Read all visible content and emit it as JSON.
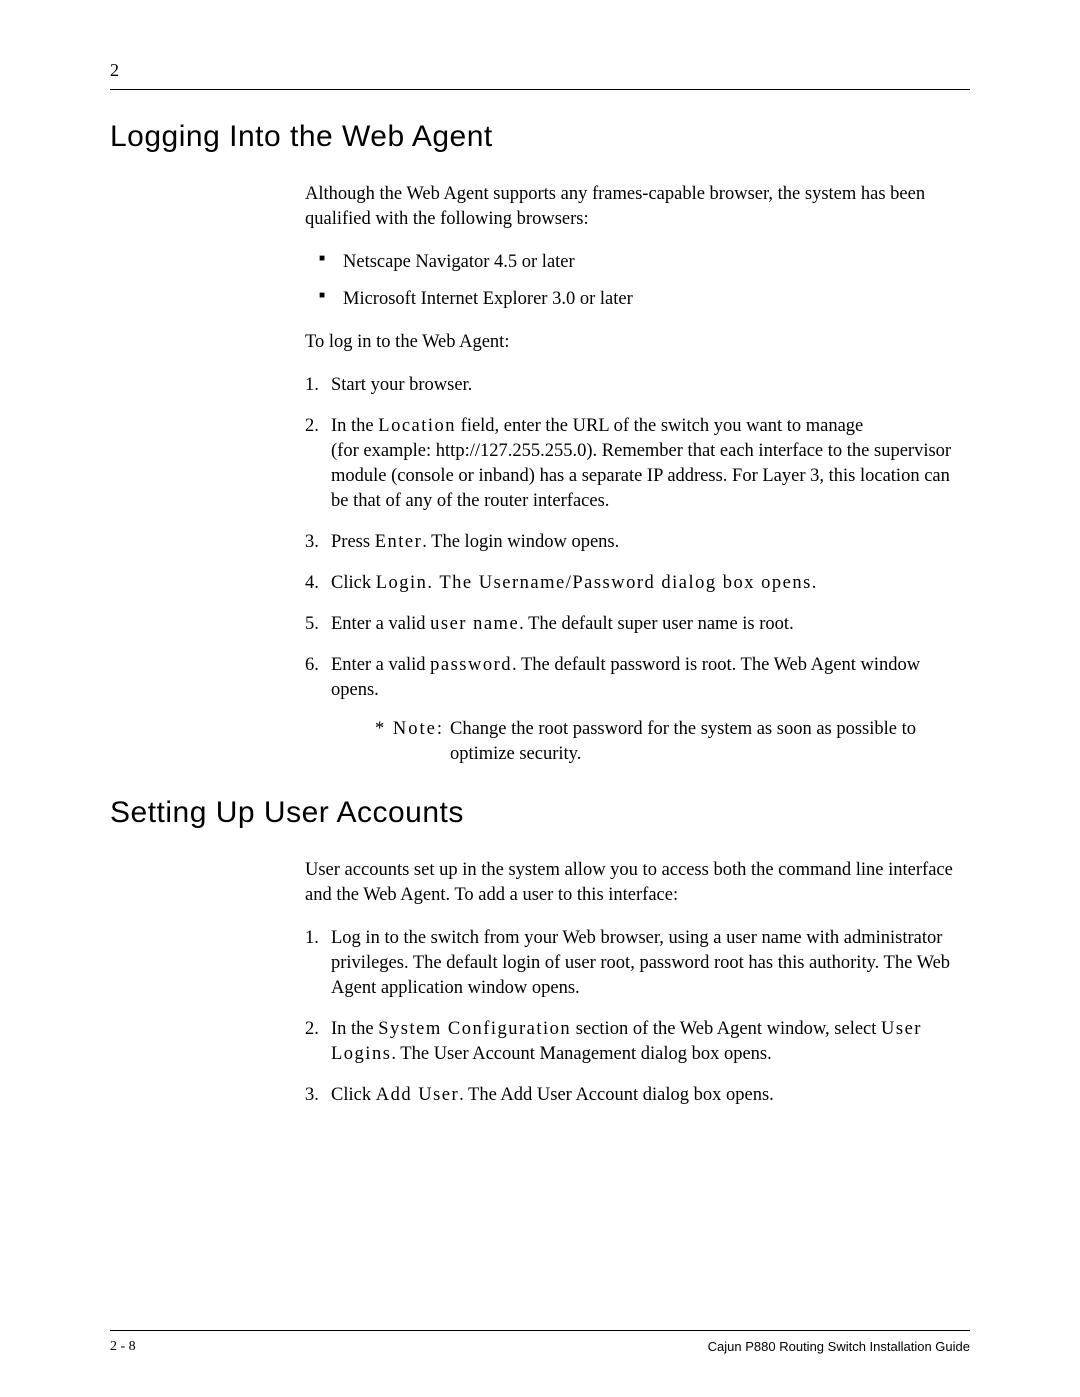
{
  "chapter_number": "2",
  "section1": {
    "heading": "Logging Into the Web Agent",
    "intro": "Although the Web Agent supports any frames-capable browser, the system has been qualified with the following browsers:",
    "bullets": [
      "Netscape Navigator 4.5 or later",
      "Microsoft Internet Explorer 3.0 or later"
    ],
    "lead": "To log in to the Web Agent:",
    "steps": {
      "s1": "Start your browser.",
      "s2a": "In the ",
      "s2b": "Location",
      "s2c": " field, enter the URL of the switch you want to manage",
      "s2d": "(for example: http://127.255.255.0). Remember that each interface to the supervisor module (console or inband) has a separate IP address. For Layer 3, this location can be that of any of the router interfaces.",
      "s3a": "Press ",
      "s3b": "Enter",
      "s3c": ". The login window opens.",
      "s4a": "Click ",
      "s4b": "Login",
      "s4c": ". The Username/Password dialog box opens.",
      "s5a": "Enter a valid ",
      "s5b": "user name",
      "s5c": ". The default super user name is ",
      "s5d": "root",
      "s5e": ".",
      "s6a": "Enter a valid ",
      "s6b": "password",
      "s6c": ". The default password is ",
      "s6d": "root",
      "s6e": ". The Web Agent window opens."
    },
    "note_label": "* Note:",
    "note_text": "Change the root password for the system as soon as possible to optimize security."
  },
  "section2": {
    "heading": "Setting Up User Accounts",
    "intro": "User accounts set up in the system allow you to access both the command line interface and the Web Agent. To add a user to this interface:",
    "steps": {
      "s1a": "Log in to the switch from your Web browser, using a user name with administrator privileges. The default login of user ",
      "s1b": "root",
      "s1c": ", password ",
      "s1d": "root",
      "s1e": " has this authority. The Web Agent application window opens.",
      "s2a": "In the ",
      "s2b": "System Configuration",
      "s2c": " section of the Web Agent window, select ",
      "s2d": "User Logins",
      "s2e": ". The User Account Management dialog box opens.",
      "s3a": "Click ",
      "s3b": "Add User",
      "s3c": ". The Add User Account dialog box opens."
    }
  },
  "footer": {
    "page": "2 - 8",
    "book": "Cajun P880 Routing Switch Installation Guide"
  }
}
